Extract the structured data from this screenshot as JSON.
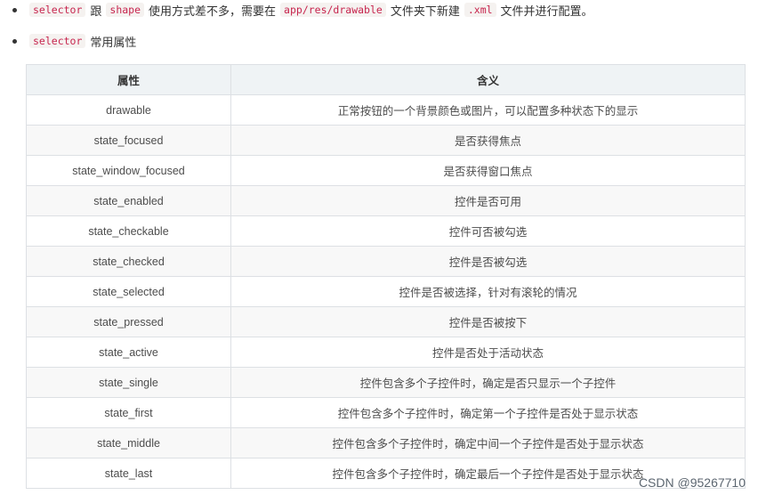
{
  "line1": {
    "code1": "selector",
    "text1": "跟",
    "code2": "shape",
    "text2": "使用方式差不多，需要在",
    "code3": "app/res/drawable",
    "text3": "文件夹下新建",
    "code4": ".xml",
    "text4": "文件并进行配置。"
  },
  "line2": {
    "code1": "selector",
    "text1": "常用属性"
  },
  "table": {
    "headers": [
      "属性",
      "含义"
    ],
    "rows": [
      [
        "drawable",
        "正常按钮的一个背景颜色或图片，可以配置多种状态下的显示"
      ],
      [
        "state_focused",
        "是否获得焦点"
      ],
      [
        "state_window_focused",
        "是否获得窗口焦点"
      ],
      [
        "state_enabled",
        "控件是否可用"
      ],
      [
        "state_checkable",
        "控件可否被勾选"
      ],
      [
        "state_checked",
        "控件是否被勾选"
      ],
      [
        "state_selected",
        "控件是否被选择，针对有滚轮的情况"
      ],
      [
        "state_pressed",
        "控件是否被按下"
      ],
      [
        "state_active",
        "控件是否处于活动状态"
      ],
      [
        "state_single",
        "控件包含多个子控件时，确定是否只显示一个子控件"
      ],
      [
        "state_first",
        "控件包含多个子控件时，确定第一个子控件是否处于显示状态"
      ],
      [
        "state_middle",
        "控件包含多个子控件时，确定中间一个子控件是否处于显示状态"
      ],
      [
        "state_last",
        "控件包含多个子控件时，确定最后一个子控件是否处于显示状态"
      ]
    ]
  },
  "watermark": "CSDN @95267710"
}
